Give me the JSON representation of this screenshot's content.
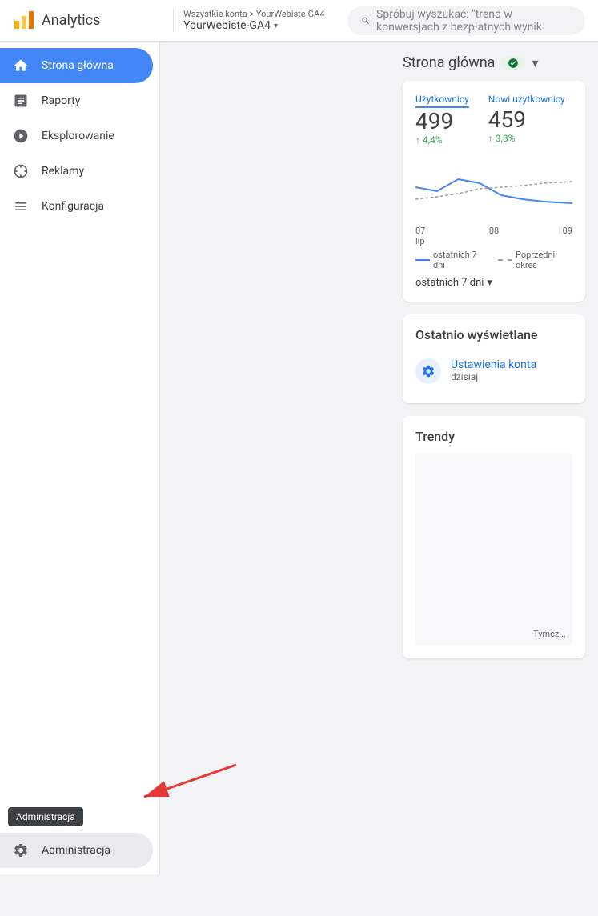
{
  "header": {
    "logo_text": "Analytics",
    "account_path": "Wszystkie konta > YourWebiste-GA4",
    "account_name": "YourWebiste-GA4",
    "search_placeholder": "Spróbuj wyszukać: \"trend w konwersjach z bezpłatnych wynik"
  },
  "sidebar": {
    "items": [
      {
        "id": "home",
        "label": "Strona główna",
        "active": true
      },
      {
        "id": "reports",
        "label": "Raporty",
        "active": false
      },
      {
        "id": "explore",
        "label": "Eksplorowanie",
        "active": false
      },
      {
        "id": "ads",
        "label": "Reklamy",
        "active": false
      },
      {
        "id": "config",
        "label": "Konfiguracja",
        "active": false
      }
    ],
    "admin_label": "Administracja",
    "admin_tooltip": "Administracja"
  },
  "main": {
    "home_title": "Strona główna",
    "stats_card": {
      "users_label": "Użytkownicy",
      "users_value": "499",
      "users_change": "↑ 4,4%",
      "new_users_label": "Nowi użytkownicy",
      "new_users_value": "459",
      "new_users_change": "↑ 3,8%",
      "date_labels": [
        "07\nLip",
        "08",
        "09"
      ],
      "legend_last7": "ostatnich 7 dni",
      "legend_prev": "Poprzedni okres",
      "date_selector": "ostatnich 7 dni"
    },
    "recently_title": "Ostatnio wyświetlane",
    "recently_item": {
      "name": "Ustawienia konta",
      "date": "dzisiaj"
    },
    "trends_title": "Trendy",
    "trends_note": "Tymcz..."
  }
}
